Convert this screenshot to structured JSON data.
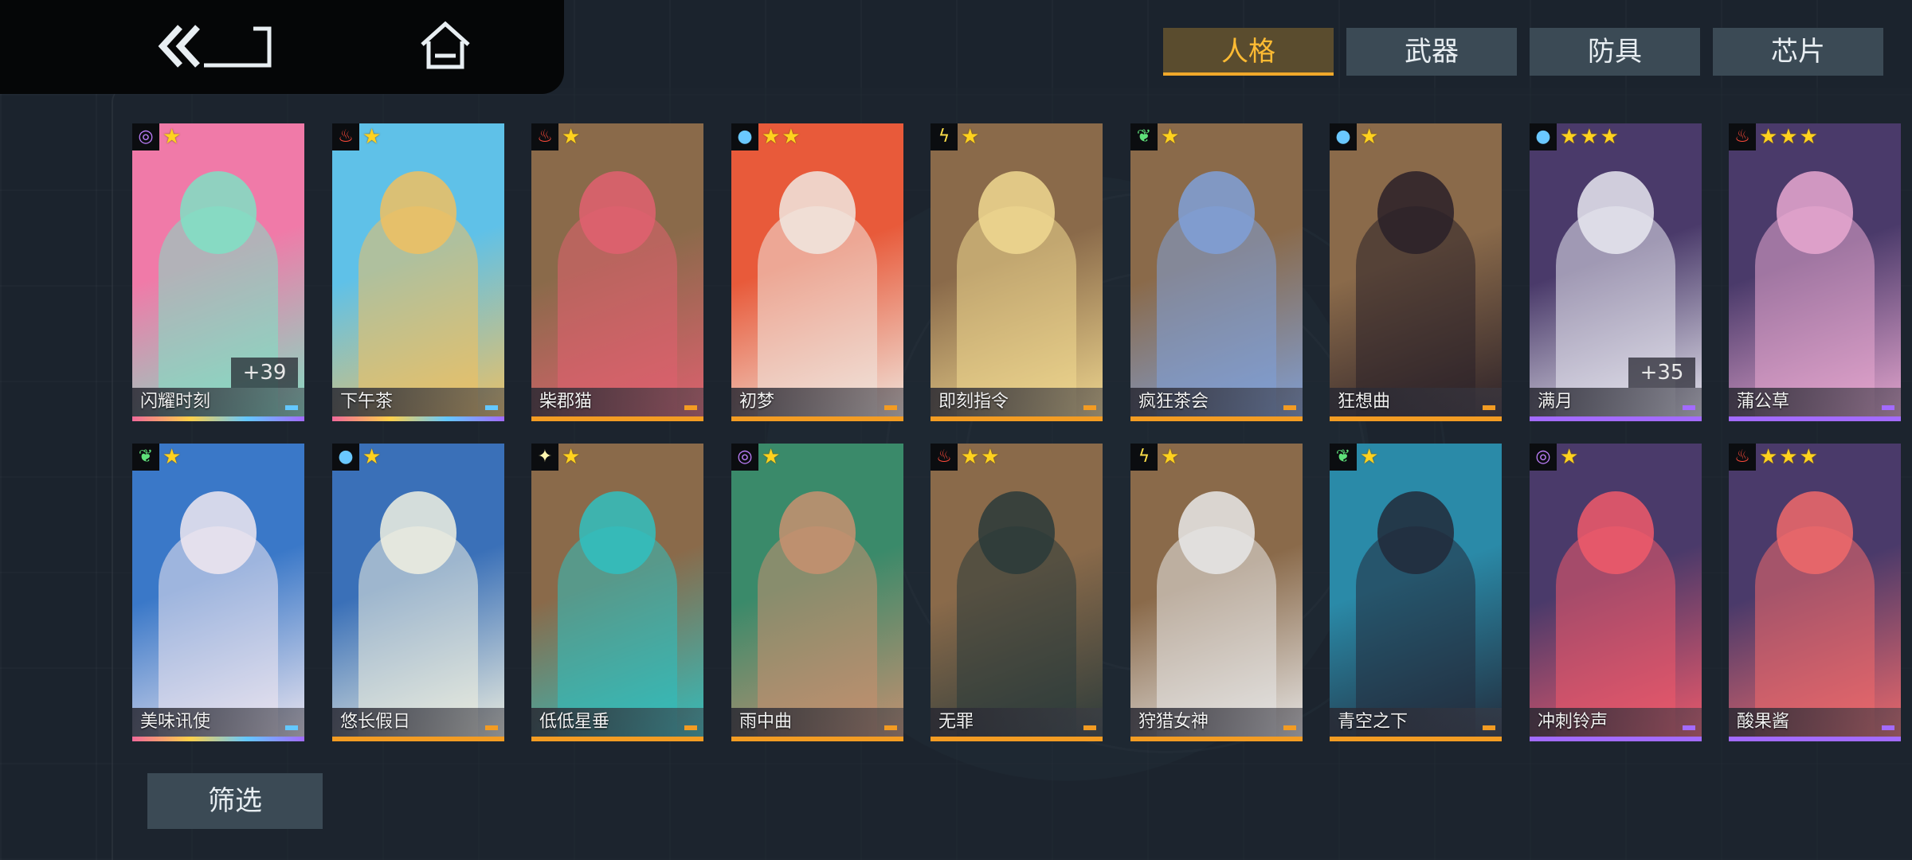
{
  "tabs": [
    {
      "label": "人格",
      "active": true
    },
    {
      "label": "武器",
      "active": false
    },
    {
      "label": "防具",
      "active": false
    },
    {
      "label": "芯片",
      "active": false
    }
  ],
  "filter_label": "筛选",
  "colors": {
    "accent": "#f0a82a",
    "rarity_orange": "#f39c23",
    "rarity_purple": "#a36bff",
    "rarity_rainbow": "#64c8ff"
  },
  "cards": [
    {
      "name": "闪耀时刻",
      "stars": "★",
      "attr": "spiral-icon",
      "attr_glyph": "◎",
      "bonus": "+39",
      "rarity": "rainbow",
      "art": [
        "#f07aa8",
        "#7fe0c4"
      ]
    },
    {
      "name": "下午茶",
      "stars": "★",
      "attr": "fire-icon",
      "attr_glyph": "♨",
      "bonus": "",
      "rarity": "rainbow",
      "art": [
        "#5fc1e8",
        "#f0c060"
      ]
    },
    {
      "name": "柴郡猫",
      "stars": "★",
      "attr": "fire-icon",
      "attr_glyph": "♨",
      "bonus": "",
      "rarity": "orange",
      "art": [
        "#8a6a4a",
        "#e06070"
      ]
    },
    {
      "name": "初梦",
      "stars": "★★",
      "attr": "water-icon",
      "attr_glyph": "●",
      "bonus": "",
      "rarity": "orange",
      "art": [
        "#e85a3a",
        "#f0e8e0"
      ]
    },
    {
      "name": "即刻指令",
      "stars": "★",
      "attr": "lightning-icon",
      "attr_glyph": "ϟ",
      "bonus": "",
      "rarity": "orange",
      "art": [
        "#8a6a4a",
        "#f0d890"
      ]
    },
    {
      "name": "疯狂茶会",
      "stars": "★",
      "attr": "leaf-icon",
      "attr_glyph": "❦",
      "bonus": "",
      "rarity": "orange",
      "art": [
        "#8a6a4a",
        "#7fa0d8"
      ]
    },
    {
      "name": "狂想曲",
      "stars": "★",
      "attr": "water-icon",
      "attr_glyph": "●",
      "bonus": "",
      "rarity": "orange",
      "art": [
        "#8a6a4a",
        "#2a2028"
      ]
    },
    {
      "name": "满月",
      "stars": "★★★",
      "attr": "water-icon",
      "attr_glyph": "●",
      "bonus": "+35",
      "rarity": "purple",
      "art": [
        "#4a3a6a",
        "#e8e8f0"
      ]
    },
    {
      "name": "蒲公草",
      "stars": "★★★",
      "attr": "fire-icon",
      "attr_glyph": "♨",
      "bonus": "",
      "rarity": "purple",
      "art": [
        "#4a3a6a",
        "#e8a8d0"
      ]
    },
    {
      "name": "美味讯使",
      "stars": "★",
      "attr": "leaf-icon",
      "attr_glyph": "❦",
      "bonus": "",
      "rarity": "rainbow",
      "art": [
        "#3a78c8",
        "#f0e8f0"
      ]
    },
    {
      "name": "悠长假日",
      "stars": "★",
      "attr": "water-icon",
      "attr_glyph": "●",
      "bonus": "",
      "rarity": "orange",
      "art": [
        "#3a70b8",
        "#f0f0e0"
      ]
    },
    {
      "name": "低低星垂",
      "stars": "★",
      "attr": "star-icon",
      "attr_glyph": "✦",
      "bonus": "",
      "rarity": "orange",
      "art": [
        "#8a6a4a",
        "#30c0c0"
      ]
    },
    {
      "name": "雨中曲",
      "stars": "★",
      "attr": "spiral-icon",
      "attr_glyph": "◎",
      "bonus": "",
      "rarity": "orange",
      "art": [
        "#3a8a6a",
        "#c89070"
      ]
    },
    {
      "name": "无罪",
      "stars": "★★",
      "attr": "fire-icon",
      "attr_glyph": "♨",
      "bonus": "",
      "rarity": "orange",
      "art": [
        "#8a6a4a",
        "#2a3a3a"
      ]
    },
    {
      "name": "狩猎女神",
      "stars": "★",
      "attr": "lightning-icon",
      "attr_glyph": "ϟ",
      "bonus": "",
      "rarity": "orange",
      "art": [
        "#8a6a4a",
        "#e8e8e8"
      ]
    },
    {
      "name": "青空之下",
      "stars": "★",
      "attr": "leaf-icon",
      "attr_glyph": "❦",
      "bonus": "",
      "rarity": "orange",
      "art": [
        "#2a8aa8",
        "#222a3a"
      ]
    },
    {
      "name": "冲刺铃声",
      "stars": "★",
      "attr": "spiral-icon",
      "attr_glyph": "◎",
      "bonus": "",
      "rarity": "purple",
      "art": [
        "#4a3a6a",
        "#f05a6a"
      ]
    },
    {
      "name": "酸果酱",
      "stars": "★★★",
      "attr": "fire-icon",
      "attr_glyph": "♨",
      "bonus": "",
      "rarity": "purple",
      "art": [
        "#4a3a6a",
        "#f06a6a"
      ]
    }
  ]
}
